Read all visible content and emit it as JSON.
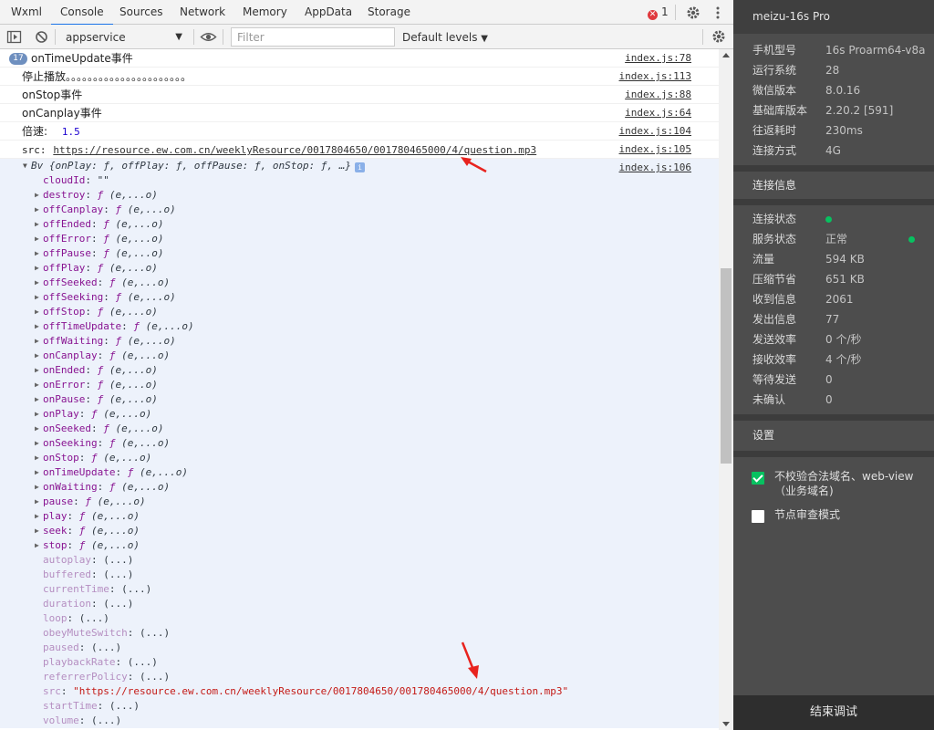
{
  "tabs": [
    "Wxml",
    "Console",
    "Sources",
    "Network",
    "Memory",
    "AppData",
    "Storage"
  ],
  "active_tab": "Console",
  "error_count": "1",
  "toolbar": {
    "context": "appservice",
    "filter_placeholder": "Filter",
    "levels": "Default levels"
  },
  "logs": [
    {
      "count": "17",
      "text": "onTimeUpdate事件",
      "source": "index.js:78"
    },
    {
      "text": "停止播放。。。。。。。。。。。。。。。。。。。。。。",
      "source": "index.js:113"
    },
    {
      "text": "onStop事件",
      "source": "index.js:88"
    },
    {
      "text": "onCanplay事件",
      "source": "index.js:64"
    },
    {
      "label": "倍速:",
      "value": "1.5",
      "source": "index.js:104"
    },
    {
      "label": "src:",
      "url": "https://resource.ew.com.cn/weeklyResource/0017804650/001780465000/4/question.mp3",
      "source": "index.js:105"
    }
  ],
  "object": {
    "summary": "Bv {onPlay: ƒ, offPlay: ƒ, offPause: ƒ, onStop: ƒ, …}",
    "source": "index.js:106",
    "info_icon": "i",
    "cloudId": {
      "key": "cloudId",
      "value": "\"\""
    },
    "methods": [
      {
        "key": "destroy",
        "sig": "(e,...o)"
      },
      {
        "key": "offCanplay",
        "sig": "(e,...o)"
      },
      {
        "key": "offEnded",
        "sig": "(e,...o)"
      },
      {
        "key": "offError",
        "sig": "(e,...o)"
      },
      {
        "key": "offPause",
        "sig": "(e,...o)"
      },
      {
        "key": "offPlay",
        "sig": "(e,...o)"
      },
      {
        "key": "offSeeked",
        "sig": "(e,...o)"
      },
      {
        "key": "offSeeking",
        "sig": "(e,...o)"
      },
      {
        "key": "offStop",
        "sig": "(e,...o)"
      },
      {
        "key": "offTimeUpdate",
        "sig": "(e,...o)"
      },
      {
        "key": "offWaiting",
        "sig": "(e,...o)"
      },
      {
        "key": "onCanplay",
        "sig": "(e,...o)"
      },
      {
        "key": "onEnded",
        "sig": "(e,...o)"
      },
      {
        "key": "onError",
        "sig": "(e,...o)"
      },
      {
        "key": "onPause",
        "sig": "(e,...o)"
      },
      {
        "key": "onPlay",
        "sig": "(e,...o)"
      },
      {
        "key": "onSeeked",
        "sig": "(e,...o)"
      },
      {
        "key": "onSeeking",
        "sig": "(e,...o)"
      },
      {
        "key": "onStop",
        "sig": "(e,...o)"
      },
      {
        "key": "onTimeUpdate",
        "sig": "(e,...o)"
      },
      {
        "key": "onWaiting",
        "sig": "(e,...o)"
      },
      {
        "key": "pause",
        "sig": "(e,...o)"
      },
      {
        "key": "play",
        "sig": "(e,...o)"
      },
      {
        "key": "seek",
        "sig": "(e,...o)"
      },
      {
        "key": "stop",
        "sig": "(e,...o)"
      }
    ],
    "accessors": [
      {
        "key": "autoplay",
        "value": "(...)"
      },
      {
        "key": "buffered",
        "value": "(...)"
      },
      {
        "key": "currentTime",
        "value": "(...)"
      },
      {
        "key": "duration",
        "value": "(...)"
      },
      {
        "key": "loop",
        "value": "(...)"
      },
      {
        "key": "obeyMuteSwitch",
        "value": "(...)"
      },
      {
        "key": "paused",
        "value": "(...)"
      },
      {
        "key": "playbackRate",
        "value": "(...)"
      },
      {
        "key": "referrerPolicy",
        "value": "(...)"
      },
      {
        "key": "src",
        "value": "\"https://resource.ew.com.cn/weeklyResource/0017804650/001780465000/4/question.mp3\"",
        "string": true
      },
      {
        "key": "startTime",
        "value": "(...)"
      },
      {
        "key": "volume",
        "value": "(...)"
      }
    ]
  },
  "panel": {
    "title": "meizu-16s Pro",
    "device_info": [
      {
        "k": "手机型号",
        "v": "16s Proarm64-v8a"
      },
      {
        "k": "运行系统",
        "v": "28"
      },
      {
        "k": "微信版本",
        "v": "8.0.16"
      },
      {
        "k": "基础库版本",
        "v": "2.20.2 [591]"
      },
      {
        "k": "往返耗时",
        "v": "230ms"
      },
      {
        "k": "连接方式",
        "v": "4G"
      }
    ],
    "connection_title": "连接信息",
    "connection": [
      {
        "k": "连接状态",
        "v": "",
        "dot": true
      },
      {
        "k": "服务状态",
        "v": "正常",
        "dot": true
      },
      {
        "k": "流量",
        "v": "594 KB"
      },
      {
        "k": "压缩节省",
        "v": "651 KB"
      },
      {
        "k": "收到信息",
        "v": "2061"
      },
      {
        "k": "发出信息",
        "v": "77"
      },
      {
        "k": "发送效率",
        "v": "0 个/秒"
      },
      {
        "k": "接收效率",
        "v": "4 个/秒"
      },
      {
        "k": "等待发送",
        "v": "0"
      },
      {
        "k": "未确认",
        "v": "0"
      }
    ],
    "settings_title": "设置",
    "settings": [
      {
        "label": "不校验合法域名、web-view（业务域名)",
        "checked": true
      },
      {
        "label": "节点审查模式",
        "checked": false
      }
    ],
    "end_button": "结束调试",
    "status_dot_color": "#07c160",
    "checkbox_on_color": "#07c160"
  },
  "colors": {
    "accent": "#1a73e8",
    "error": "#e0393e",
    "object_bg": "#edf2fb",
    "annotation_arrow": "#e8231e"
  }
}
